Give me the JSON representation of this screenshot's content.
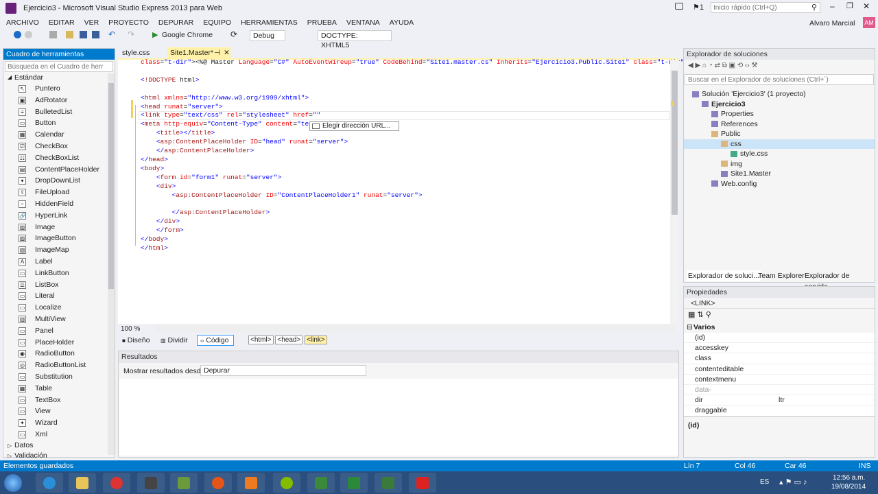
{
  "window": {
    "title": "Ejercicio3 - Microsoft Visual Studio Express 2013 para Web",
    "quick_launch_placeholder": "Inicio rápido (Ctrl+Q)",
    "user": "Alvaro Marcial",
    "user_initials": "AM",
    "flag_count": "1"
  },
  "menu": [
    "ARCHIVO",
    "EDITAR",
    "VER",
    "PROYECTO",
    "DEPURAR",
    "EQUIPO",
    "HERRAMIENTAS",
    "PRUEBA",
    "VENTANA",
    "AYUDA"
  ],
  "toolbar": {
    "browser": "Google Chrome",
    "config": "Debug",
    "doctype": "DOCTYPE: XHTML5"
  },
  "toolbox": {
    "title": "Cuadro de herramientas",
    "search_placeholder": "Búsqueda en el Cuadro de herr",
    "section": "Estándar",
    "items": [
      "Puntero",
      "AdRotator",
      "BulletedList",
      "Button",
      "Calendar",
      "CheckBox",
      "CheckBoxList",
      "ContentPlaceHolder",
      "DropDownList",
      "FileUpload",
      "HiddenField",
      "HyperLink",
      "Image",
      "ImageButton",
      "ImageMap",
      "Label",
      "LinkButton",
      "ListBox",
      "Literal",
      "Localize",
      "MultiView",
      "Panel",
      "PlaceHolder",
      "RadioButton",
      "RadioButtonList",
      "Substitution",
      "Table",
      "TextBox",
      "View",
      "Wizard",
      "Xml"
    ],
    "footer_sections": [
      "Datos",
      "Validación"
    ]
  },
  "editor": {
    "tabs": [
      {
        "label": "style.css"
      },
      {
        "label": "Site1.Master*"
      }
    ],
    "zoom": "100 %",
    "view_buttons": [
      "Diseño",
      "Dividir",
      "Código"
    ],
    "breadcrumbs": [
      "<html>",
      "<head>",
      "<link>"
    ],
    "intellisense": "Elegir dirección URL...",
    "lines": [
      "<%@ Master Language=\"C#\" AutoEventWireup=\"true\" CodeBehind=\"Site1.master.cs\" Inherits=\"Ejercicio3.Public.Site1\" %>",
      "",
      "<!DOCTYPE html>",
      "",
      "<html xmlns=\"http://www.w3.org/1999/xhtml\">",
      "<head runat=\"server\">",
      "<link type=\"text/css\" rel=\"stylesheet\" href=\"\"",
      "<meta http-equiv=\"Content-Type\" content=\"tex",
      "    <title></title>",
      "    <asp:ContentPlaceHolder ID=\"head\" runat=\"server\">",
      "    </asp:ContentPlaceHolder>",
      "</head>",
      "<body>",
      "    <form id=\"form1\" runat=\"server\">",
      "    <div>",
      "        <asp:ContentPlaceHolder ID=\"ContentPlaceHolder1\" runat=\"server\">",
      "",
      "        </asp:ContentPlaceHolder>",
      "    </div>",
      "    </form>",
      "</body>",
      "</html>"
    ]
  },
  "output": {
    "title": "Resultados",
    "label": "Mostrar resultados desde:",
    "source": "Depurar"
  },
  "solution": {
    "title": "Explorador de soluciones",
    "search_placeholder": "Buscar en el Explorador de soluciones (Ctrl+´)",
    "items": [
      {
        "label": "Solución 'Ejercicio3' (1 proyecto)",
        "depth": 0
      },
      {
        "label": "Ejercicio3",
        "depth": 1
      },
      {
        "label": "Properties",
        "depth": 2
      },
      {
        "label": "References",
        "depth": 2
      },
      {
        "label": "Public",
        "depth": 2
      },
      {
        "label": "css",
        "depth": 3
      },
      {
        "label": "style.css",
        "depth": 4
      },
      {
        "label": "img",
        "depth": 3
      },
      {
        "label": "Site1.Master",
        "depth": 3
      },
      {
        "label": "Web.config",
        "depth": 2
      }
    ],
    "tabs": [
      "Explorador de soluci...",
      "Team Explorer",
      "Explorador de servido..."
    ]
  },
  "properties": {
    "title": "Propiedades",
    "object": "<LINK>",
    "category": "Varios",
    "rows": [
      {
        "k": "(id)",
        "v": ""
      },
      {
        "k": "accesskey",
        "v": ""
      },
      {
        "k": "class",
        "v": ""
      },
      {
        "k": "contenteditable",
        "v": ""
      },
      {
        "k": "contextmenu",
        "v": ""
      },
      {
        "k": "data-",
        "v": ""
      },
      {
        "k": "dir",
        "v": "ltr"
      },
      {
        "k": "draggable",
        "v": ""
      }
    ],
    "description": "(id)"
  },
  "status": {
    "message": "Elementos guardados",
    "line": "Lín 7",
    "col": "Col 46",
    "car": "Car 46",
    "mode": "INS"
  },
  "taskbar": {
    "lang": "ES",
    "time": "12:56 a.m.",
    "date": "19/08/2014"
  }
}
